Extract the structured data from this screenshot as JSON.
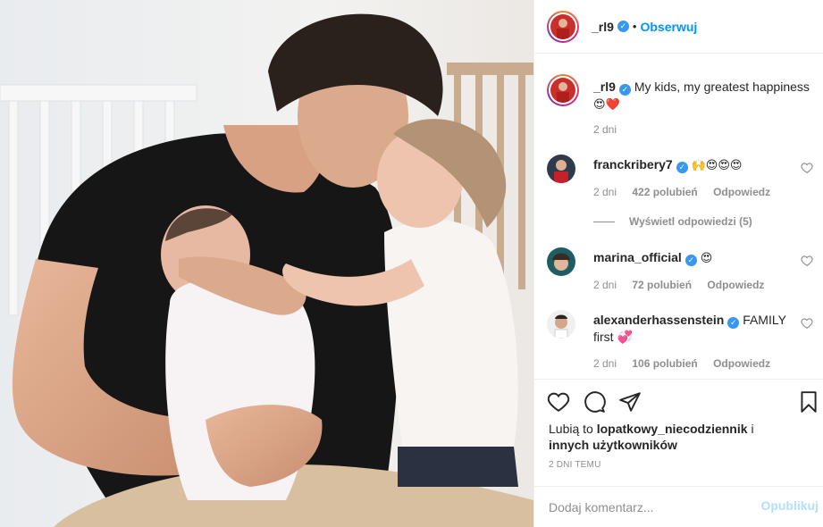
{
  "header": {
    "username": "_rl9",
    "separator": "•",
    "follow_label": "Obserwuj"
  },
  "caption": {
    "username": "_rl9",
    "text": "My kids, my greatest happiness",
    "emoji": "😍❤️",
    "time": "2 dni"
  },
  "comments": [
    {
      "username": "franckribery7",
      "text": "🙌😍😍😍",
      "time": "2 dni",
      "likes": "422 polubień",
      "reply_label": "Odpowiedz"
    },
    {
      "username": "marina_official",
      "text": "😍",
      "time": "2 dni",
      "likes": "72 polubień",
      "reply_label": "Odpowiedz"
    },
    {
      "username": "alexanderhassenstein",
      "text": "FAMILY first 💞",
      "time": "2 dni",
      "likes": "106 polubień",
      "reply_label": "Odpowiedz"
    }
  ],
  "view_replies_label": "Wyświetl odpowiedzi (5)",
  "likes_line": {
    "prefix": "Lubią to",
    "user": "lopatkowy_niecodziennik",
    "middle": "i",
    "suffix": "innych użytkowników"
  },
  "post_time": "2 DNI TEMU",
  "add_comment": {
    "placeholder": "Dodaj komentarz...",
    "post_label": "Opublikuj"
  },
  "colors": {
    "accent": "#0095f6",
    "verified": "#3897f0",
    "muted": "#8e8e8e",
    "border": "#efefef"
  }
}
